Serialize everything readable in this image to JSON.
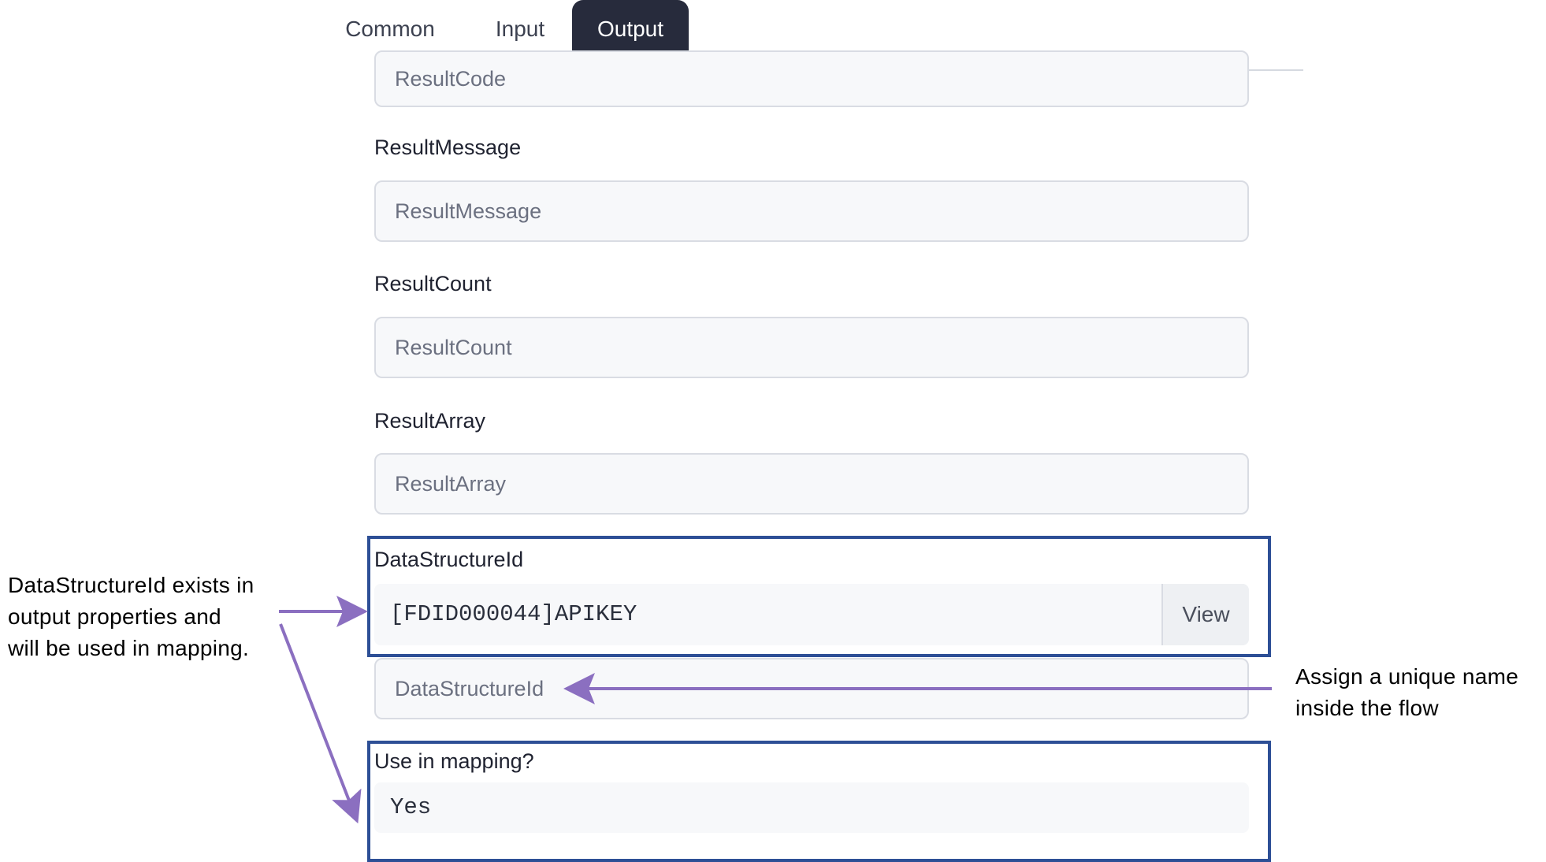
{
  "tabs": [
    {
      "label": "Common",
      "active": false
    },
    {
      "label": "Input",
      "active": false
    },
    {
      "label": "Output",
      "active": true
    }
  ],
  "fields": {
    "result_code": {
      "placeholder": "ResultCode"
    },
    "result_message": {
      "label": "ResultMessage",
      "placeholder": "ResultMessage"
    },
    "result_count": {
      "label": "ResultCount",
      "placeholder": "ResultCount"
    },
    "result_array": {
      "label": "ResultArray",
      "placeholder": "ResultArray"
    },
    "data_structure_id": {
      "label": "DataStructureId",
      "selected_value": "[FDID000044]APIKEY",
      "view_button": "View",
      "name_placeholder": "DataStructureId"
    },
    "use_in_mapping": {
      "label": "Use in mapping?",
      "value": "Yes"
    }
  },
  "annotations": {
    "left_note": {
      "line1": "DataStructureId exists in",
      "line2": "output properties and",
      "line3": "will be used in mapping."
    },
    "right_note": {
      "line1": "Assign a unique name",
      "line2": "inside the flow"
    }
  },
  "colors": {
    "active_tab": "#272b3c",
    "highlight_box": "#2d4f96",
    "arrow": "#8b6fc0"
  }
}
